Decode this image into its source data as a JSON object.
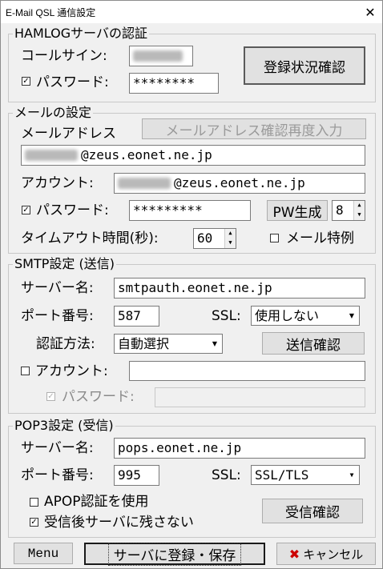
{
  "window": {
    "title": "E-Mail QSL 通信設定"
  },
  "hamlog": {
    "group_title": "HAMLOGサーバの認証",
    "callsign_label": "コールサイン:",
    "password_label": "パスワード:",
    "password_value": "********",
    "password_checked": true,
    "check_button": "登録状況確認"
  },
  "mail": {
    "group_title": "メールの設定",
    "address_label": "メールアドレス",
    "reconfirm_button": "メールアドレス確認再度入力",
    "address_suffix": "@zeus.eonet.ne.jp",
    "account_label": "アカウント:",
    "account_suffix": "@zeus.eonet.ne.jp",
    "password_label": "パスワード:",
    "password_value": "*********",
    "password_checked": true,
    "pw_generate_button": "PW生成",
    "pw_length": "8",
    "timeout_label": "タイムアウト時間(秒):",
    "timeout_value": "60",
    "special_label": "メール特例",
    "special_checked": false
  },
  "smtp": {
    "group_title": "SMTP設定 (送信)",
    "server_label": "サーバー名:",
    "server_value": "smtpauth.eonet.ne.jp",
    "port_label": "ポート番号:",
    "port_value": "587",
    "ssl_label": "SSL:",
    "ssl_value": "使用しない",
    "auth_label": "認証方法:",
    "auth_value": "自動選択",
    "send_check_button": "送信確認",
    "account_label": "アカウント:",
    "account_checked": false,
    "password_label": "パスワード:",
    "password_checked": true
  },
  "pop3": {
    "group_title": "POP3設定 (受信)",
    "server_label": "サーバー名:",
    "server_value": "pops.eonet.ne.jp",
    "port_label": "ポート番号:",
    "port_value": "995",
    "ssl_label": "SSL:",
    "ssl_value": "SSL/TLS",
    "apop_label": "APOP認証を使用",
    "apop_checked": false,
    "no_keep_label": "受信後サーバに残さない",
    "no_keep_checked": true,
    "receive_check_button": "受信確認"
  },
  "footer": {
    "menu_button": "Menu",
    "save_button": "サーバに登録・保存",
    "cancel_button": "キャンセル"
  },
  "icons": {
    "check_mark": "✓",
    "close": "✕",
    "cancel": "✖",
    "dropdown": "▼",
    "spin_up": "▲",
    "spin_down": "▼"
  },
  "colors": {
    "cancel_icon": "#cc0000"
  }
}
